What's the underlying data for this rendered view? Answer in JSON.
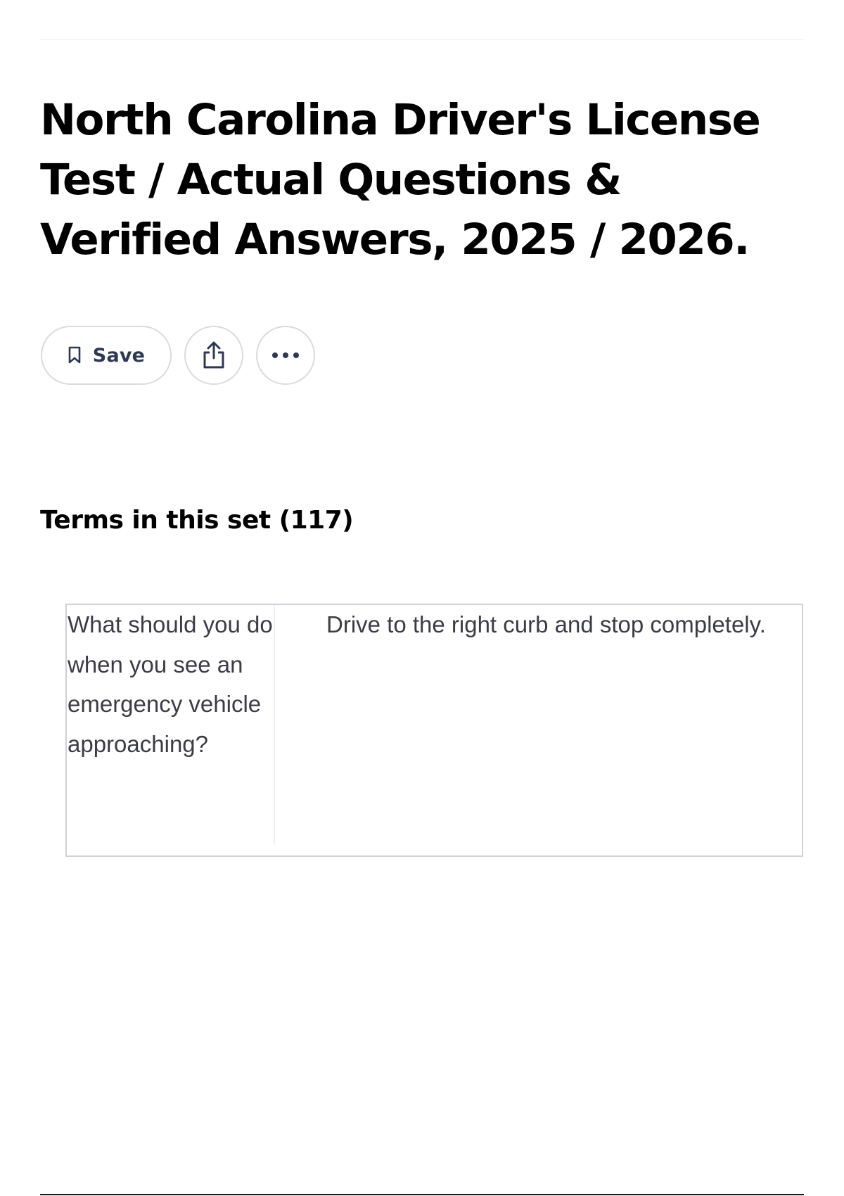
{
  "page": {
    "title": "North Carolina Driver's License Test / Actual Questions & Verified Answers, 2025 / 2026."
  },
  "actions": {
    "save_label": "Save",
    "save_icon": "bookmark-icon",
    "share_icon": "share-icon",
    "more_icon": "more-horizontal-icon"
  },
  "terms_section": {
    "heading": "Terms in this set (117)"
  },
  "cards": [
    {
      "term": "What should you do when you see an emergency vehicle approaching?",
      "definition": "Drive to the right curb and stop completely."
    }
  ],
  "colors": {
    "text_primary": "#000000",
    "text_secondary": "#2e3856",
    "card_text": "#3c3c46",
    "border": "#d9dbe3"
  }
}
